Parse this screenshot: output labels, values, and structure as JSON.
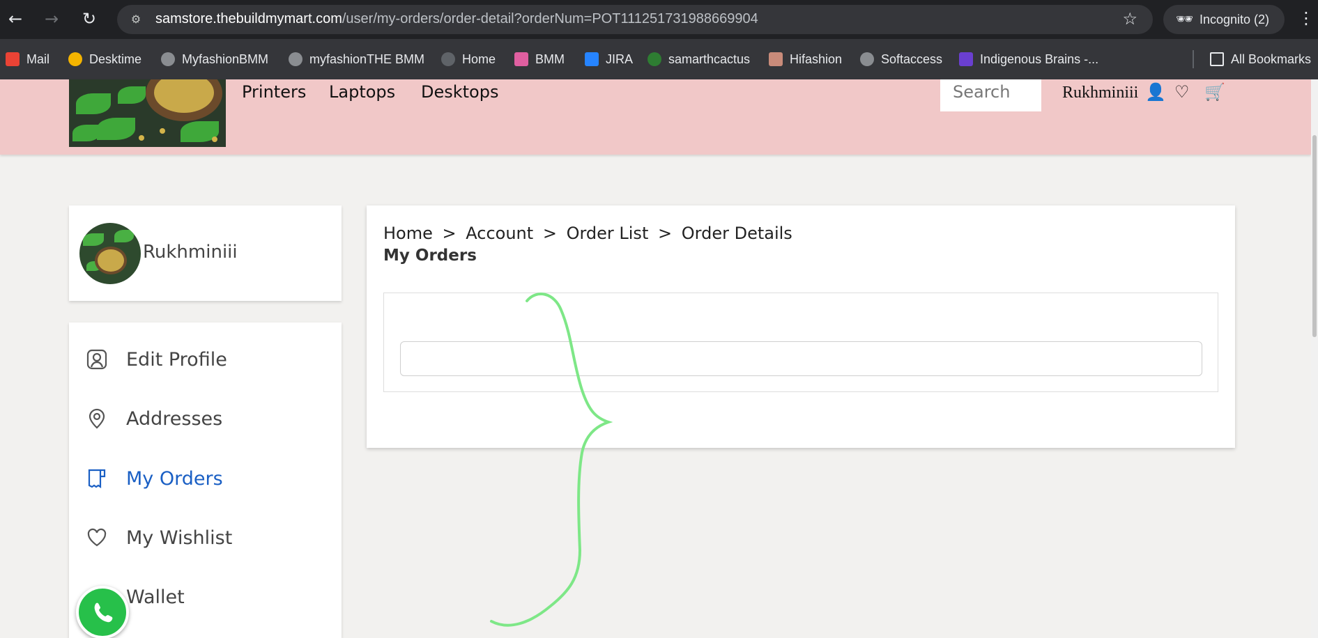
{
  "browser": {
    "url_host": "samstore.thebuildmymart.com",
    "url_path": "/user/my-orders/order-detail?orderNum=POT111251731988669904",
    "incognito_label": "Incognito (2)",
    "bookmarks": [
      "Mail",
      "Desktime",
      "MyfashionBMM",
      "myfashionTHE BMM",
      "Home",
      "BMM",
      "JIRA",
      "samarthcactus",
      "Hifashion",
      "Softaccess",
      "Indigenous Brains -..."
    ],
    "all_bookmarks_label": "All Bookmarks"
  },
  "header": {
    "nav": [
      "Printers",
      "Laptops",
      "Desktops"
    ],
    "search_placeholder": "Search",
    "user_name": "Rukhminiii"
  },
  "sidebar": {
    "profile_name": "Rukhminiii",
    "items": [
      {
        "label": "Edit Profile",
        "icon": "user-badge-icon"
      },
      {
        "label": "Addresses",
        "icon": "location-pin-icon"
      },
      {
        "label": "My Orders",
        "icon": "receipt-icon",
        "active": true
      },
      {
        "label": "My Wishlist",
        "icon": "heart-icon"
      },
      {
        "label": "Wallet",
        "icon": "wallet-icon"
      }
    ]
  },
  "main": {
    "breadcrumb": [
      "Home",
      ">",
      "Account",
      ">",
      "Order List",
      ">",
      "Order Details"
    ],
    "title": "My Orders"
  },
  "colors": {
    "header_bg": "#f1c8c8",
    "active": "#1a5fc4",
    "annotation": "#7ee787",
    "whatsapp": "#27c04a"
  }
}
